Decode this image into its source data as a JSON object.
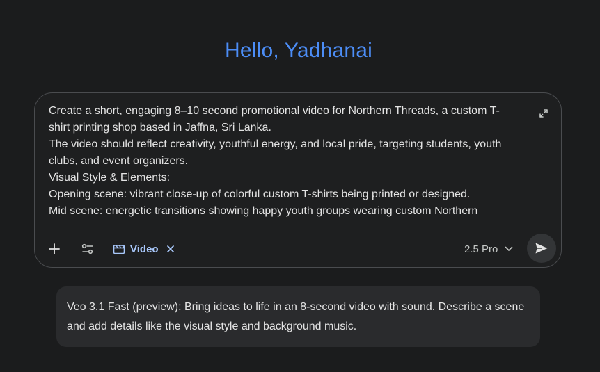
{
  "greeting": "Hello, Yadhanai",
  "prompt": {
    "lines": [
      "Create a short, engaging 8–10 second promotional video for Northern Threads, a custom T-",
      "shirt printing shop based in Jaffna, Sri Lanka.",
      "The video should reflect creativity, youthful energy, and local pride, targeting students, youth",
      "clubs, and event organizers.",
      "Visual Style & Elements:",
      "Opening scene: vibrant close-up of colorful custom T-shirts being printed or designed.",
      "Mid scene: energetic transitions showing happy youth groups wearing custom Northern"
    ]
  },
  "toolbar": {
    "add_icon": "plus-icon",
    "tools_icon": "sliders-icon",
    "video_chip_icon": "clapperboard-icon",
    "video_chip_label": "Video",
    "chip_close_icon": "close-icon",
    "model_label": "2.5 Pro",
    "model_chevron_icon": "chevron-down-icon",
    "send_icon": "send-icon",
    "expand_icon": "expand-icon"
  },
  "info_card": {
    "text": "Veo 3.1 Fast (preview): Bring ideas to life in an 8-second video with sound. Describe a scene and add details like the visual style and background music."
  },
  "colors": {
    "background": "#1b1c1d",
    "greeting": "#4c8df6",
    "chip_accent": "#a8c7fa",
    "text": "#e3e3e3"
  }
}
